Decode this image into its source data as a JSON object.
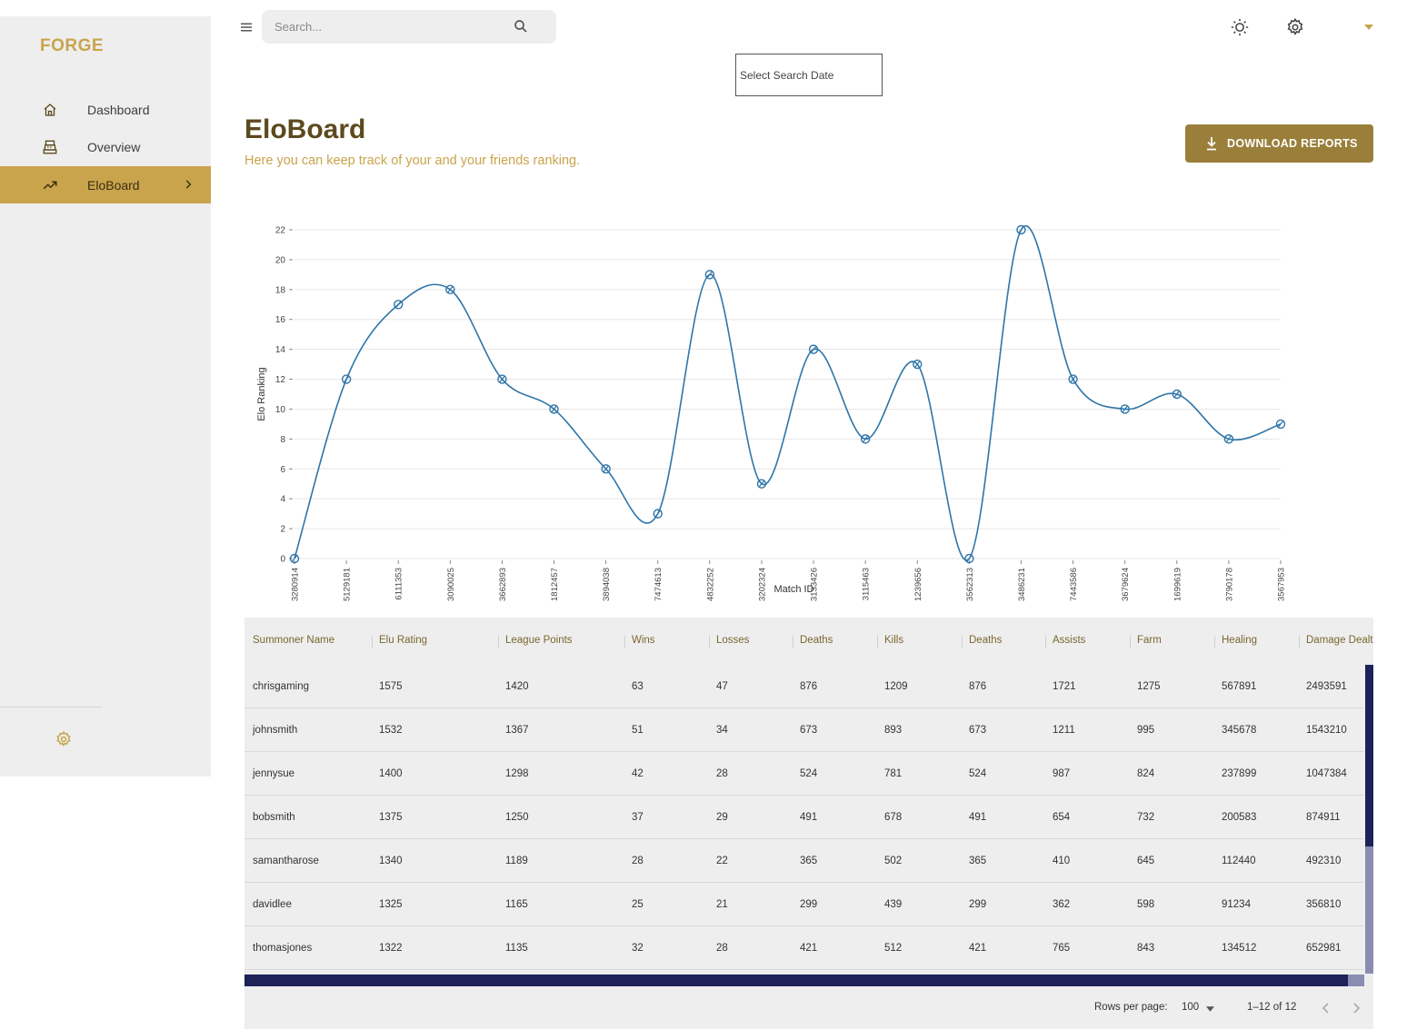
{
  "brand": "FORGE",
  "sidebar": {
    "items": [
      {
        "label": "Dashboard",
        "icon": "home-icon"
      },
      {
        "label": "Overview",
        "icon": "cash-register-icon"
      },
      {
        "label": "EloBoard",
        "icon": "trending-up-icon"
      }
    ],
    "active": "EloBoard"
  },
  "topbar": {
    "search_placeholder": "Search...",
    "date_placeholder": "Select Search Date"
  },
  "page": {
    "title": "EloBoard",
    "subtitle": "Here you can keep track of your and your friends ranking.",
    "download_label": "DOWNLOAD REPORTS"
  },
  "colors": {
    "accent": "#c9a44c",
    "accent_dark": "#9a7f3b",
    "title": "#5c4a1e",
    "line": "#2f75a8",
    "scroll": "#1f2159"
  },
  "chart_data": {
    "type": "line",
    "xlabel": "Match ID",
    "ylabel": "Elo Ranking",
    "ylim": [
      0,
      22
    ],
    "yticks": [
      0,
      2,
      4,
      6,
      8,
      10,
      12,
      14,
      16,
      18,
      20,
      22
    ],
    "grid": true,
    "x": [
      "3280914",
      "5129181",
      "6111353",
      "3090025",
      "3662893",
      "1812457",
      "3894038",
      "7474613",
      "4832252",
      "3202324",
      "3133426",
      "3115463",
      "1239656",
      "3562313",
      "3486231",
      "7443586",
      "3679624",
      "1699619",
      "3790178",
      "3567953"
    ],
    "values": [
      0,
      12,
      17,
      18,
      12,
      10,
      6,
      3,
      19,
      5,
      14,
      8,
      13,
      0,
      22,
      12,
      10,
      11,
      8,
      9
    ]
  },
  "table": {
    "columns": [
      "Summoner Name",
      "Elu Rating",
      "League Points",
      "Wins",
      "Losses",
      "Deaths",
      "Kills",
      "Deaths",
      "Assists",
      "Farm",
      "Healing",
      "Damage Dealt"
    ],
    "rows": [
      [
        "chrisgaming",
        "1575",
        "1420",
        "63",
        "47",
        "876",
        "1209",
        "876",
        "1721",
        "1275",
        "567891",
        "2493591"
      ],
      [
        "johnsmith",
        "1532",
        "1367",
        "51",
        "34",
        "673",
        "893",
        "673",
        "1211",
        "995",
        "345678",
        "1543210"
      ],
      [
        "jennysue",
        "1400",
        "1298",
        "42",
        "28",
        "524",
        "781",
        "524",
        "987",
        "824",
        "237899",
        "1047384"
      ],
      [
        "bobsmith",
        "1375",
        "1250",
        "37",
        "29",
        "491",
        "678",
        "491",
        "654",
        "732",
        "200583",
        "874911"
      ],
      [
        "samantharose",
        "1340",
        "1189",
        "28",
        "22",
        "365",
        "502",
        "365",
        "410",
        "645",
        "112440",
        "492310"
      ],
      [
        "davidlee",
        "1325",
        "1165",
        "25",
        "21",
        "299",
        "439",
        "299",
        "362",
        "598",
        "91234",
        "356810"
      ],
      [
        "thomasjones",
        "1322",
        "1135",
        "32",
        "28",
        "421",
        "512",
        "421",
        "765",
        "843",
        "134512",
        "652981"
      ]
    ],
    "footer": {
      "rows_per_page_label": "Rows per page:",
      "rows_per_page": "100",
      "range": "1–12 of 12"
    }
  }
}
